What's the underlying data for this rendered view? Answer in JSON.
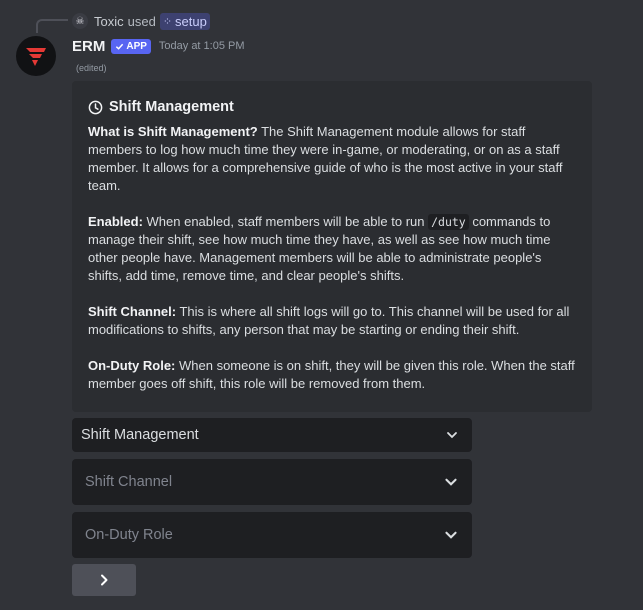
{
  "reply": {
    "user": "Toxic",
    "used_text": "used",
    "command": "setup"
  },
  "message": {
    "author": "ERM",
    "badge": "APP",
    "timestamp": "Today at 1:05 PM",
    "edited": "(edited)"
  },
  "embed": {
    "title": "Shift Management",
    "sections": [
      {
        "label": "What is Shift Management?",
        "text": " The Shift Management module allows for staff members to log how much time they were in-game, or moderating, or on as a staff member. It allows for a comprehensive guide of who is the most active in your staff team."
      },
      {
        "label": "Enabled:",
        "text_before_code": " When enabled, staff members will be able to run ",
        "code": "/duty",
        "text_after_code": " commands to manage their shift, see how much time they have, as well as see how much time other people have. Management members will be able to administrate people's shifts, add time, remove time, and clear people's shifts."
      },
      {
        "label": "Shift Channel:",
        "text": " This is where all shift logs will go to. This channel will be used for all modifications to shifts, any person that may be starting or ending their shift."
      },
      {
        "label": "On-Duty Role:",
        "text": " When someone is on shift, they will be given this role. When the staff member goes off shift, this role will be removed from them."
      }
    ]
  },
  "components": {
    "module_select": "Shift Management",
    "channel_select_placeholder": "Shift Channel",
    "role_select_placeholder": "On-Duty Role",
    "next_button": "chevron-right-icon"
  },
  "colors": {
    "background": "#313338",
    "embed": "#2b2d31",
    "accent": "#5865f2",
    "select_bg": "#1e1f22"
  }
}
